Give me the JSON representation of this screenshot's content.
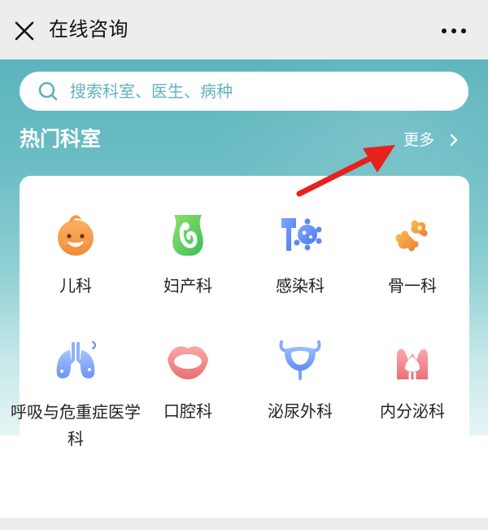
{
  "header": {
    "title": "在线咨询",
    "close_icon": "close-icon",
    "more_icon": "more-dots-icon"
  },
  "search": {
    "placeholder": "搜索科室、医生、病种",
    "icon": "search-icon"
  },
  "section": {
    "title": "热门科室",
    "more_label": "更多",
    "more_icon": "chevron-right-icon"
  },
  "departments": [
    {
      "label": "儿科",
      "icon": "baby-face-icon"
    },
    {
      "label": "妇产科",
      "icon": "uterus-icon"
    },
    {
      "label": "感染科",
      "icon": "virus-icon"
    },
    {
      "label": "骨一科",
      "icon": "bone-icon"
    },
    {
      "label": "呼吸与危重症医学科",
      "icon": "lungs-icon"
    },
    {
      "label": "口腔科",
      "icon": "mouth-icon"
    },
    {
      "label": "泌尿外科",
      "icon": "bladder-icon"
    },
    {
      "label": "内分泌科",
      "icon": "thyroid-icon"
    }
  ],
  "colors": {
    "hero_top": "#5cb4bd",
    "search_placeholder": "#63b3bd",
    "annotation_arrow": "#e8201e"
  }
}
